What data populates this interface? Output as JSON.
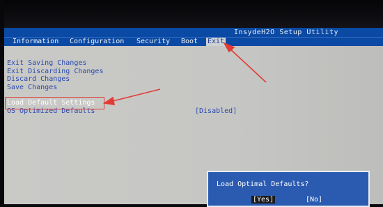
{
  "bios": {
    "title": "InsydeH2O Setup Utility",
    "menu": [
      "Information",
      "Configuration",
      "Security",
      "Boot",
      "Exit"
    ],
    "selected_menu": "Exit"
  },
  "exit_options": [
    "Exit Saving Changes",
    "Exit Discarding Changes",
    "Discard Changes",
    "Save Changes"
  ],
  "load_default": "Load Default Settings",
  "os_optimized": {
    "label": "OS Optimized Defaults",
    "value": "[Disabled]"
  },
  "dialog": {
    "question": "Load Optimal Defaults?",
    "yes": "[Yes]",
    "no": "[No]"
  },
  "colors": {
    "annotation": "#e23b35",
    "menu_blue": "#0b4aa4",
    "option_blue": "#2a49b0"
  }
}
